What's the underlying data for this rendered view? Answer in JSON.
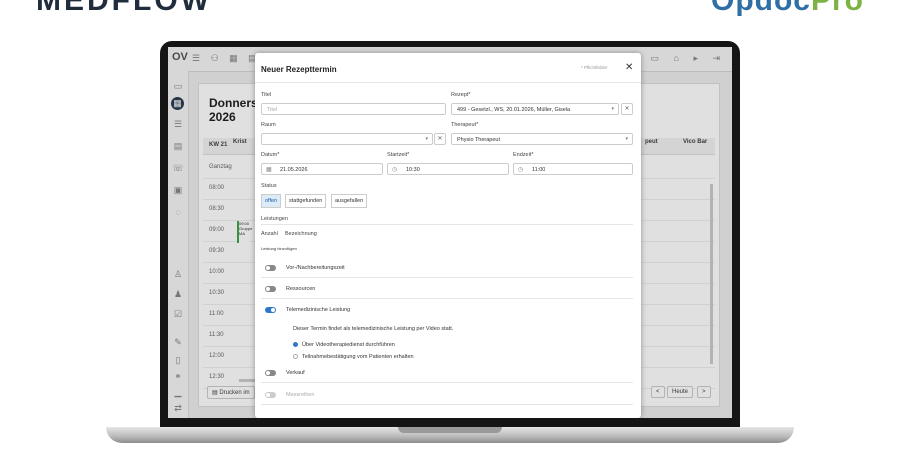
{
  "app": {
    "brand_left": "MEDFLOW",
    "brand_right_main": "Opdoc",
    "brand_right_accent": "Pro",
    "topbar_logo": "OV"
  },
  "calendar": {
    "title_line1": "Donnerst",
    "title_line2": "2026",
    "week": "KW 21",
    "col_krist": "Krist",
    "col_peut": "peut",
    "col_vico": "Vico Bar",
    "allday": "Ganztag",
    "times": [
      "08:00",
      "08:30",
      "09:00",
      "09:30",
      "10:00",
      "10:30",
      "11:00",
      "11:30",
      "12:00",
      "12:30"
    ],
    "event_text": "09:00 Gruppe MA",
    "footer_print": "Drucken im",
    "footer_today": "Heute",
    "footer_prev": "<",
    "footer_next": ">"
  },
  "modal": {
    "title": "Neuer Rezepttermin",
    "required_note": "* Pflichtfelder",
    "close": "✕",
    "titel_label": "Titel",
    "titel_placeholder": "Titel",
    "rezept_label": "Rezept*",
    "rezept_value": "499 - Gesetzl., WS, 20.01.2026, Müller, Gisela",
    "raum_label": "Raum",
    "raum_value": "",
    "therapeut_label": "Therapeut*",
    "therapeut_value": "Physio Therapeut",
    "datum_label": "Datum*",
    "datum_value": "21.05.2026",
    "start_label": "Startzeit*",
    "start_value": "10:30",
    "end_label": "Endzeit*",
    "end_value": "11:00",
    "status_label": "Status",
    "status_options": [
      "offen",
      "stattgefunden",
      "ausgefallen"
    ],
    "status_selected": "offen",
    "leistungen_label": "Leistungen",
    "anzahl_label": "Anzahl",
    "bezeichnung_label": "Bezeichnung",
    "add_leistung": "Leistung hinzufügen",
    "toggles": [
      {
        "label": "Vor-/Nachbereitungszeit",
        "on": false
      },
      {
        "label": "Ressourcen",
        "on": false
      },
      {
        "label": "Telemedizinische Leistung",
        "on": true
      },
      {
        "label": "Verkauf",
        "on": false
      },
      {
        "label": "Messreihen",
        "on": false
      }
    ],
    "tele_info": "Dieser Termin findet als telemedizinische Leistung per Video statt.",
    "radio_options": [
      {
        "label": "Über Videotherapiedienst durchführen",
        "checked": true
      },
      {
        "label": "Teilnahmebestätigung vom Patienten erhalten",
        "checked": false
      }
    ]
  }
}
